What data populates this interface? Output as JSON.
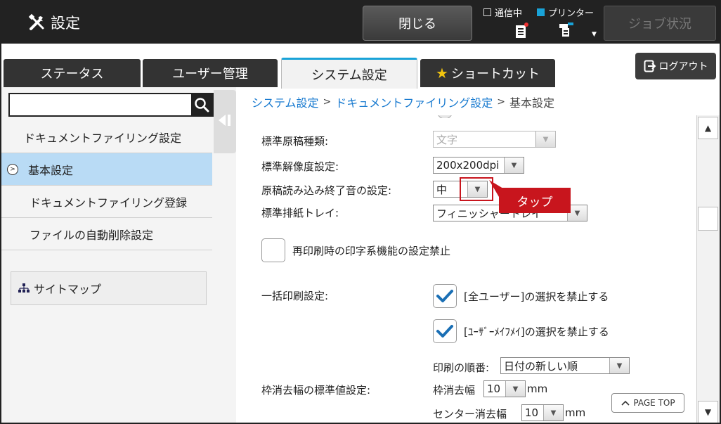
{
  "header": {
    "title": "設定",
    "close_label": "閉じる",
    "comm_label": "通信中",
    "printer_label": "プリンター",
    "job_label": "ジョブ状況"
  },
  "tabs": [
    {
      "label": "ステータス"
    },
    {
      "label": "ユーザー管理"
    },
    {
      "label": "システム設定",
      "active": true
    },
    {
      "label": "ショートカット"
    }
  ],
  "logout_label": "ログアウト",
  "sidebar": {
    "search_value": "",
    "items": [
      {
        "label": "ドキュメントファイリング設定"
      },
      {
        "label": "基本設定",
        "selected": true
      },
      {
        "label": "ドキュメントファイリング登録"
      },
      {
        "label": "ファイルの自動削除設定"
      }
    ],
    "sitemap_label": "サイトマップ"
  },
  "breadcrumb": {
    "items": [
      "システム設定",
      "ドキュメントファイリング設定",
      "基本設定"
    ],
    "separator": ">"
  },
  "form": {
    "original_type": {
      "label": "標準原稿種類:",
      "value": "文字"
    },
    "resolution": {
      "label": "標準解像度設定:",
      "value": "200x200dpi"
    },
    "scan_end_sound": {
      "label": "原稿読み込み終了音の設定:",
      "value": "中"
    },
    "output_tray": {
      "label": "標準排紙トレイ:",
      "value": "フィニッシャートレイ"
    },
    "reprint_disable": {
      "label": "再印刷時の印字系機能の設定禁止",
      "checked": false
    },
    "batch_print": {
      "label": "一括印刷設定:",
      "all_users": {
        "label": "[全ユーザー]の選択を禁止する",
        "checked": true
      },
      "user_unknown": {
        "label": "[ﾕｰｻﾞｰﾒｲﾌﾒｲ]の選択を禁止する",
        "checked": true
      },
      "print_order_label": "印刷の順番:",
      "print_order_value": "日付の新しい順"
    },
    "erase_width": {
      "label": "枠消去幅の標準値設定:",
      "frame_label": "枠消去幅",
      "frame_value": "10",
      "center_label": "センター消去幅",
      "center_value": "10",
      "unit": "mm"
    }
  },
  "callout": {
    "label": "タップ",
    "color": "#c8151d"
  },
  "page_top_label": "PAGE TOP",
  "colors": {
    "accent": "#19a3d8",
    "link": "#1a7bd0",
    "selected_row": "#b9dbf5",
    "check": "#1a6fb5"
  }
}
